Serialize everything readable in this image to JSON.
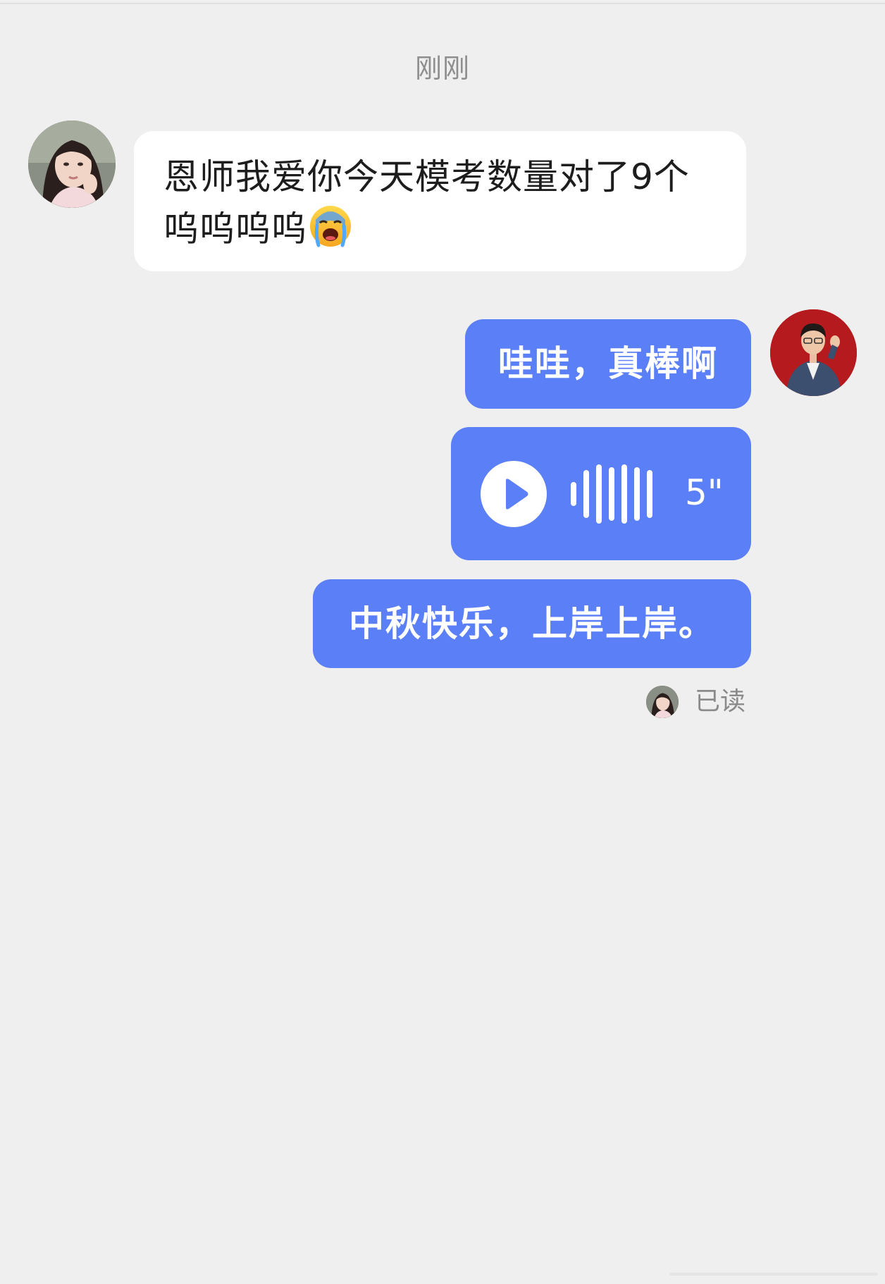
{
  "timestamp": "刚刚",
  "messages": {
    "incoming": {
      "text": "恩师我爱你今天模考数量对了9个呜呜呜呜",
      "emoji": "crying-emoji"
    },
    "outgoing": [
      {
        "type": "text",
        "text": "哇哇，真棒啊"
      },
      {
        "type": "voice",
        "duration": "5\""
      },
      {
        "type": "text",
        "text": "中秋快乐，上岸上岸。"
      }
    ]
  },
  "read_status": "已读",
  "colors": {
    "background": "#efefef",
    "outgoing_bubble": "#5b7ff7",
    "incoming_bubble": "#ffffff",
    "timestamp_text": "#8e8e8e"
  }
}
